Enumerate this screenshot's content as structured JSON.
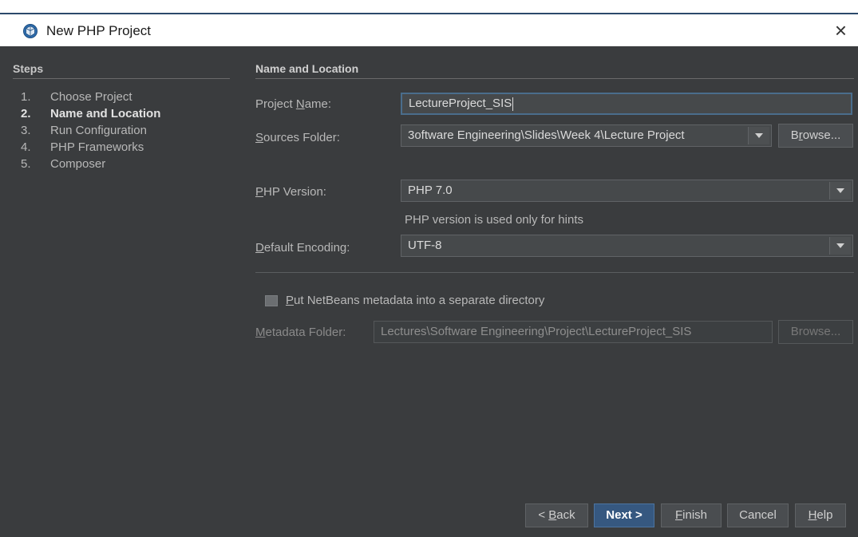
{
  "window": {
    "title": "New PHP Project",
    "close_glyph": "×",
    "icon": "project-cube-icon"
  },
  "steps": {
    "title": "Steps",
    "current_index": 1,
    "items": [
      {
        "num": "1.",
        "label": "Choose Project"
      },
      {
        "num": "2.",
        "label": "Name and Location"
      },
      {
        "num": "3.",
        "label": "Run Configuration"
      },
      {
        "num": "4.",
        "label": "PHP Frameworks"
      },
      {
        "num": "5.",
        "label": "Composer"
      }
    ]
  },
  "form": {
    "section_title": "Name and Location",
    "project_name": {
      "label_pre": "Project ",
      "label_mn": "N",
      "label_post": "ame:",
      "value": "LectureProject_SIS"
    },
    "sources_folder": {
      "label_pre": "",
      "label_mn": "S",
      "label_post": "ources Folder:",
      "value": "3oftware Engineering\\Slides\\Week 4\\Lecture Project"
    },
    "browse": {
      "label_pre": "B",
      "label_mn": "r",
      "label_post": "owse..."
    },
    "php_version": {
      "label_pre": "",
      "label_mn": "P",
      "label_post": "HP Version:",
      "value": "PHP 7.0",
      "hint": "PHP version is used only for hints"
    },
    "encoding": {
      "label_pre": "",
      "label_mn": "D",
      "label_post": "efault Encoding:",
      "value": "UTF-8"
    },
    "metadata_checkbox": {
      "label_pre": "",
      "label_mn": "P",
      "label_post": "ut NetBeans metadata into a separate directory",
      "checked": false
    },
    "metadata_folder": {
      "label_pre": "",
      "label_mn": "M",
      "label_post": "etadata Folder:",
      "value": "Lectures\\Software Engineering\\Project\\LectureProject_SIS"
    },
    "metadata_browse": {
      "label": "Browse..."
    }
  },
  "buttons": {
    "back": {
      "label_pre": "< ",
      "label_mn": "B",
      "label_post": "ack"
    },
    "next": {
      "label": "Next >"
    },
    "finish": {
      "label_pre": "",
      "label_mn": "F",
      "label_post": "inish"
    },
    "cancel": {
      "label": "Cancel"
    },
    "help": {
      "label_pre": "",
      "label_mn": "H",
      "label_post": "elp"
    }
  },
  "colors": {
    "panel_bg": "#3a3c3e",
    "primary_button": "#365880",
    "focus_border": "#4a6d8c"
  }
}
